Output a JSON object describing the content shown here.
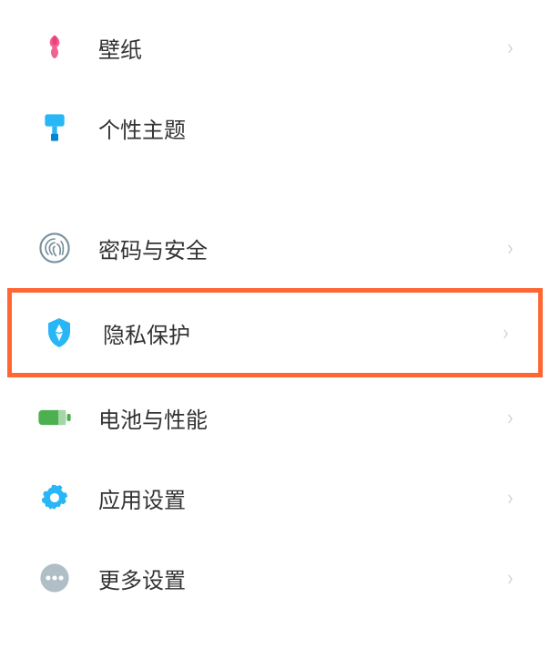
{
  "settings": {
    "group1": [
      {
        "label": "壁纸",
        "icon": "tulip"
      },
      {
        "label": "个性主题",
        "icon": "brush"
      }
    ],
    "group2": [
      {
        "label": "密码与安全",
        "icon": "fingerprint"
      },
      {
        "label": "隐私保护",
        "icon": "shield",
        "highlighted": true
      },
      {
        "label": "电池与性能",
        "icon": "battery"
      },
      {
        "label": "应用设置",
        "icon": "gear"
      },
      {
        "label": "更多设置",
        "icon": "more"
      }
    ]
  },
  "colors": {
    "highlight_border": "#ff6633",
    "text": "#333333",
    "chevron": "#cccccc",
    "tulip": "#f06292",
    "brush": "#29b6f6",
    "fingerprint": "#78909c",
    "shield": "#29b6f6",
    "battery": "#4caf50",
    "gear": "#29b6f6",
    "more": "#b0bec5"
  }
}
